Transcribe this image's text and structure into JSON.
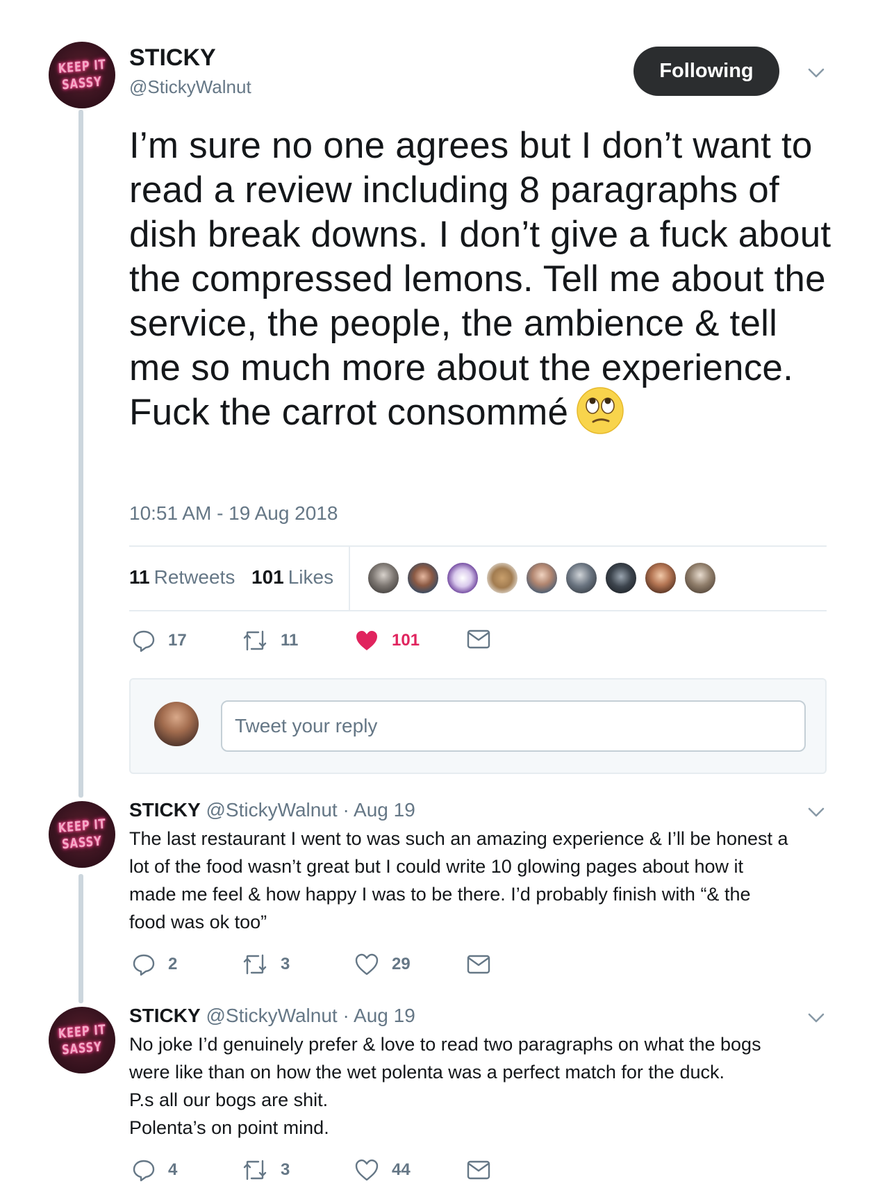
{
  "tweet": {
    "display_name": "STICKY",
    "handle": "@StickyWalnut",
    "avatar_text": [
      "KEEP IT",
      "SASSY"
    ],
    "follow_label": "Following",
    "text": "I’m sure no one agrees but I don’t want to read a review including 8 paragraphs of dish break downs. I don’t give a fuck about the compressed lemons. Tell me about the service, the people, the ambience & tell me so much more about the experience. Fuck the carrot consommé",
    "emoji": "face-with-rolling-eyes",
    "timestamp": "10:51 AM - 19 Aug 2018",
    "retweets_count": "11",
    "retweets_label": "Retweets",
    "likes_count": "101",
    "likes_label": "Likes",
    "actions": {
      "replies": "17",
      "retweets": "11",
      "likes": "101"
    },
    "liked": true
  },
  "reply_box": {
    "placeholder": "Tweet your reply"
  },
  "replies": [
    {
      "display_name": "STICKY",
      "handle": "@StickyWalnut",
      "date": "· Aug 19",
      "lines": [
        "The last restaurant I went to was such an amazing experience & I’ll be honest a",
        "lot of the food wasn’t great but I could write 10 glowing pages about how it",
        "made me feel & how happy I was to be there. I’d probably finish with “& the",
        "food was ok too”"
      ],
      "actions": {
        "replies": "2",
        "retweets": "3",
        "likes": "29"
      }
    },
    {
      "display_name": "STICKY",
      "handle": "@StickyWalnut",
      "date": "· Aug 19",
      "lines": [
        "No joke I’d genuinely prefer & love to read two paragraphs on what the bogs",
        "were like than on how the wet polenta was a perfect match for the duck.",
        "P.s all our bogs are shit.",
        "Polenta’s on point mind."
      ],
      "actions": {
        "replies": "4",
        "retweets": "3",
        "likes": "44"
      }
    }
  ],
  "colors": {
    "like_red": "#e0245e",
    "secondary_text": "#657786",
    "primary_text": "#14171a",
    "follow_button": "#2b2d2f"
  }
}
